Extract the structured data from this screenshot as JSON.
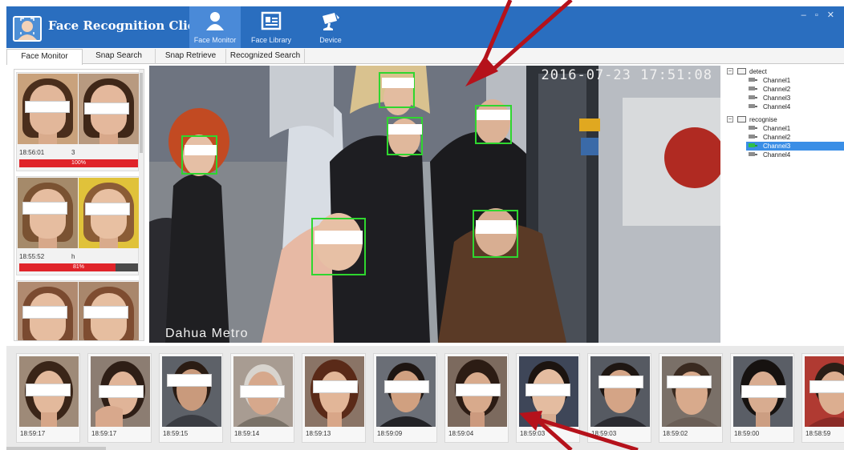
{
  "app": {
    "title": "Face Recognition Client",
    "window_controls": "– ▫ ✕"
  },
  "nav": [
    {
      "label": "Face Monitor",
      "icon": "user-icon",
      "active": true
    },
    {
      "label": "Face Library",
      "icon": "id-card-icon",
      "active": false
    },
    {
      "label": "Device",
      "icon": "camera-icon",
      "active": false
    }
  ],
  "tabs": [
    "Face Monitor",
    "Snap Search",
    "Snap Retrieve",
    "Recognized Search"
  ],
  "match_cards": [
    {
      "time": "18:56:01",
      "name": "3",
      "similarity": 100,
      "similarity_label": "100%"
    },
    {
      "time": "18:55:52",
      "name": "h",
      "similarity": 81,
      "similarity_label": "81%"
    },
    {
      "time": "",
      "name": "",
      "similarity": null,
      "similarity_label": ""
    }
  ],
  "video": {
    "timestamp": "2016-07-23 17:51:08",
    "watermark": "Dahua Metro"
  },
  "tree": {
    "groups": [
      {
        "label": "detect",
        "expander": "−",
        "channels": [
          "Channel1",
          "Channel2",
          "Channel3",
          "Channel4"
        ]
      },
      {
        "label": "recognise",
        "expander": "−",
        "channels": [
          "Channel1",
          "Channel2",
          "Channel3",
          "Channel4"
        ]
      }
    ],
    "selected": "recognise/Channel3"
  },
  "snapshots": [
    {
      "time": "18:59:17"
    },
    {
      "time": "18:59:17"
    },
    {
      "time": "18:59:15"
    },
    {
      "time": "18:59:14"
    },
    {
      "time": "18:59:13"
    },
    {
      "time": "18:59:09"
    },
    {
      "time": "18:59:04"
    },
    {
      "time": "18:59:03"
    },
    {
      "time": "18:59:03"
    },
    {
      "time": "18:59:02"
    },
    {
      "time": "18:59:00"
    },
    {
      "time": "18:58:59"
    }
  ],
  "colors": {
    "titlebar": "#2a6ebf",
    "nav_active": "#4a8ad8",
    "face_box": "#2fd62f",
    "similarity_bar": "#e0242a",
    "tree_selected": "#3a8ee6",
    "annotation_arrow": "#b5121b"
  }
}
